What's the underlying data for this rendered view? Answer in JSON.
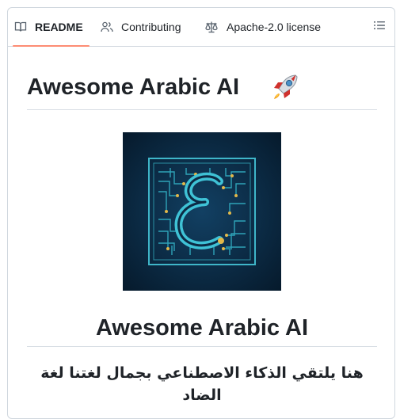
{
  "tabs": {
    "readme": "README",
    "contributing": "Contributing",
    "license": "Apache-2.0 license"
  },
  "readme": {
    "title": "Awesome Arabic AI",
    "title_emoji": "rocket-icon",
    "subtitle": "Awesome Arabic AI",
    "arabic_tagline": "هنا يلتقي الذكاء الاصطناعي بجمال لغتنا لغة الضاد"
  },
  "colors": {
    "active_tab_underline": "#fd8c73",
    "logo_background": "#0c2a44",
    "circuit": "#3fb6c9",
    "circuit_dots": "#e2b84a"
  }
}
